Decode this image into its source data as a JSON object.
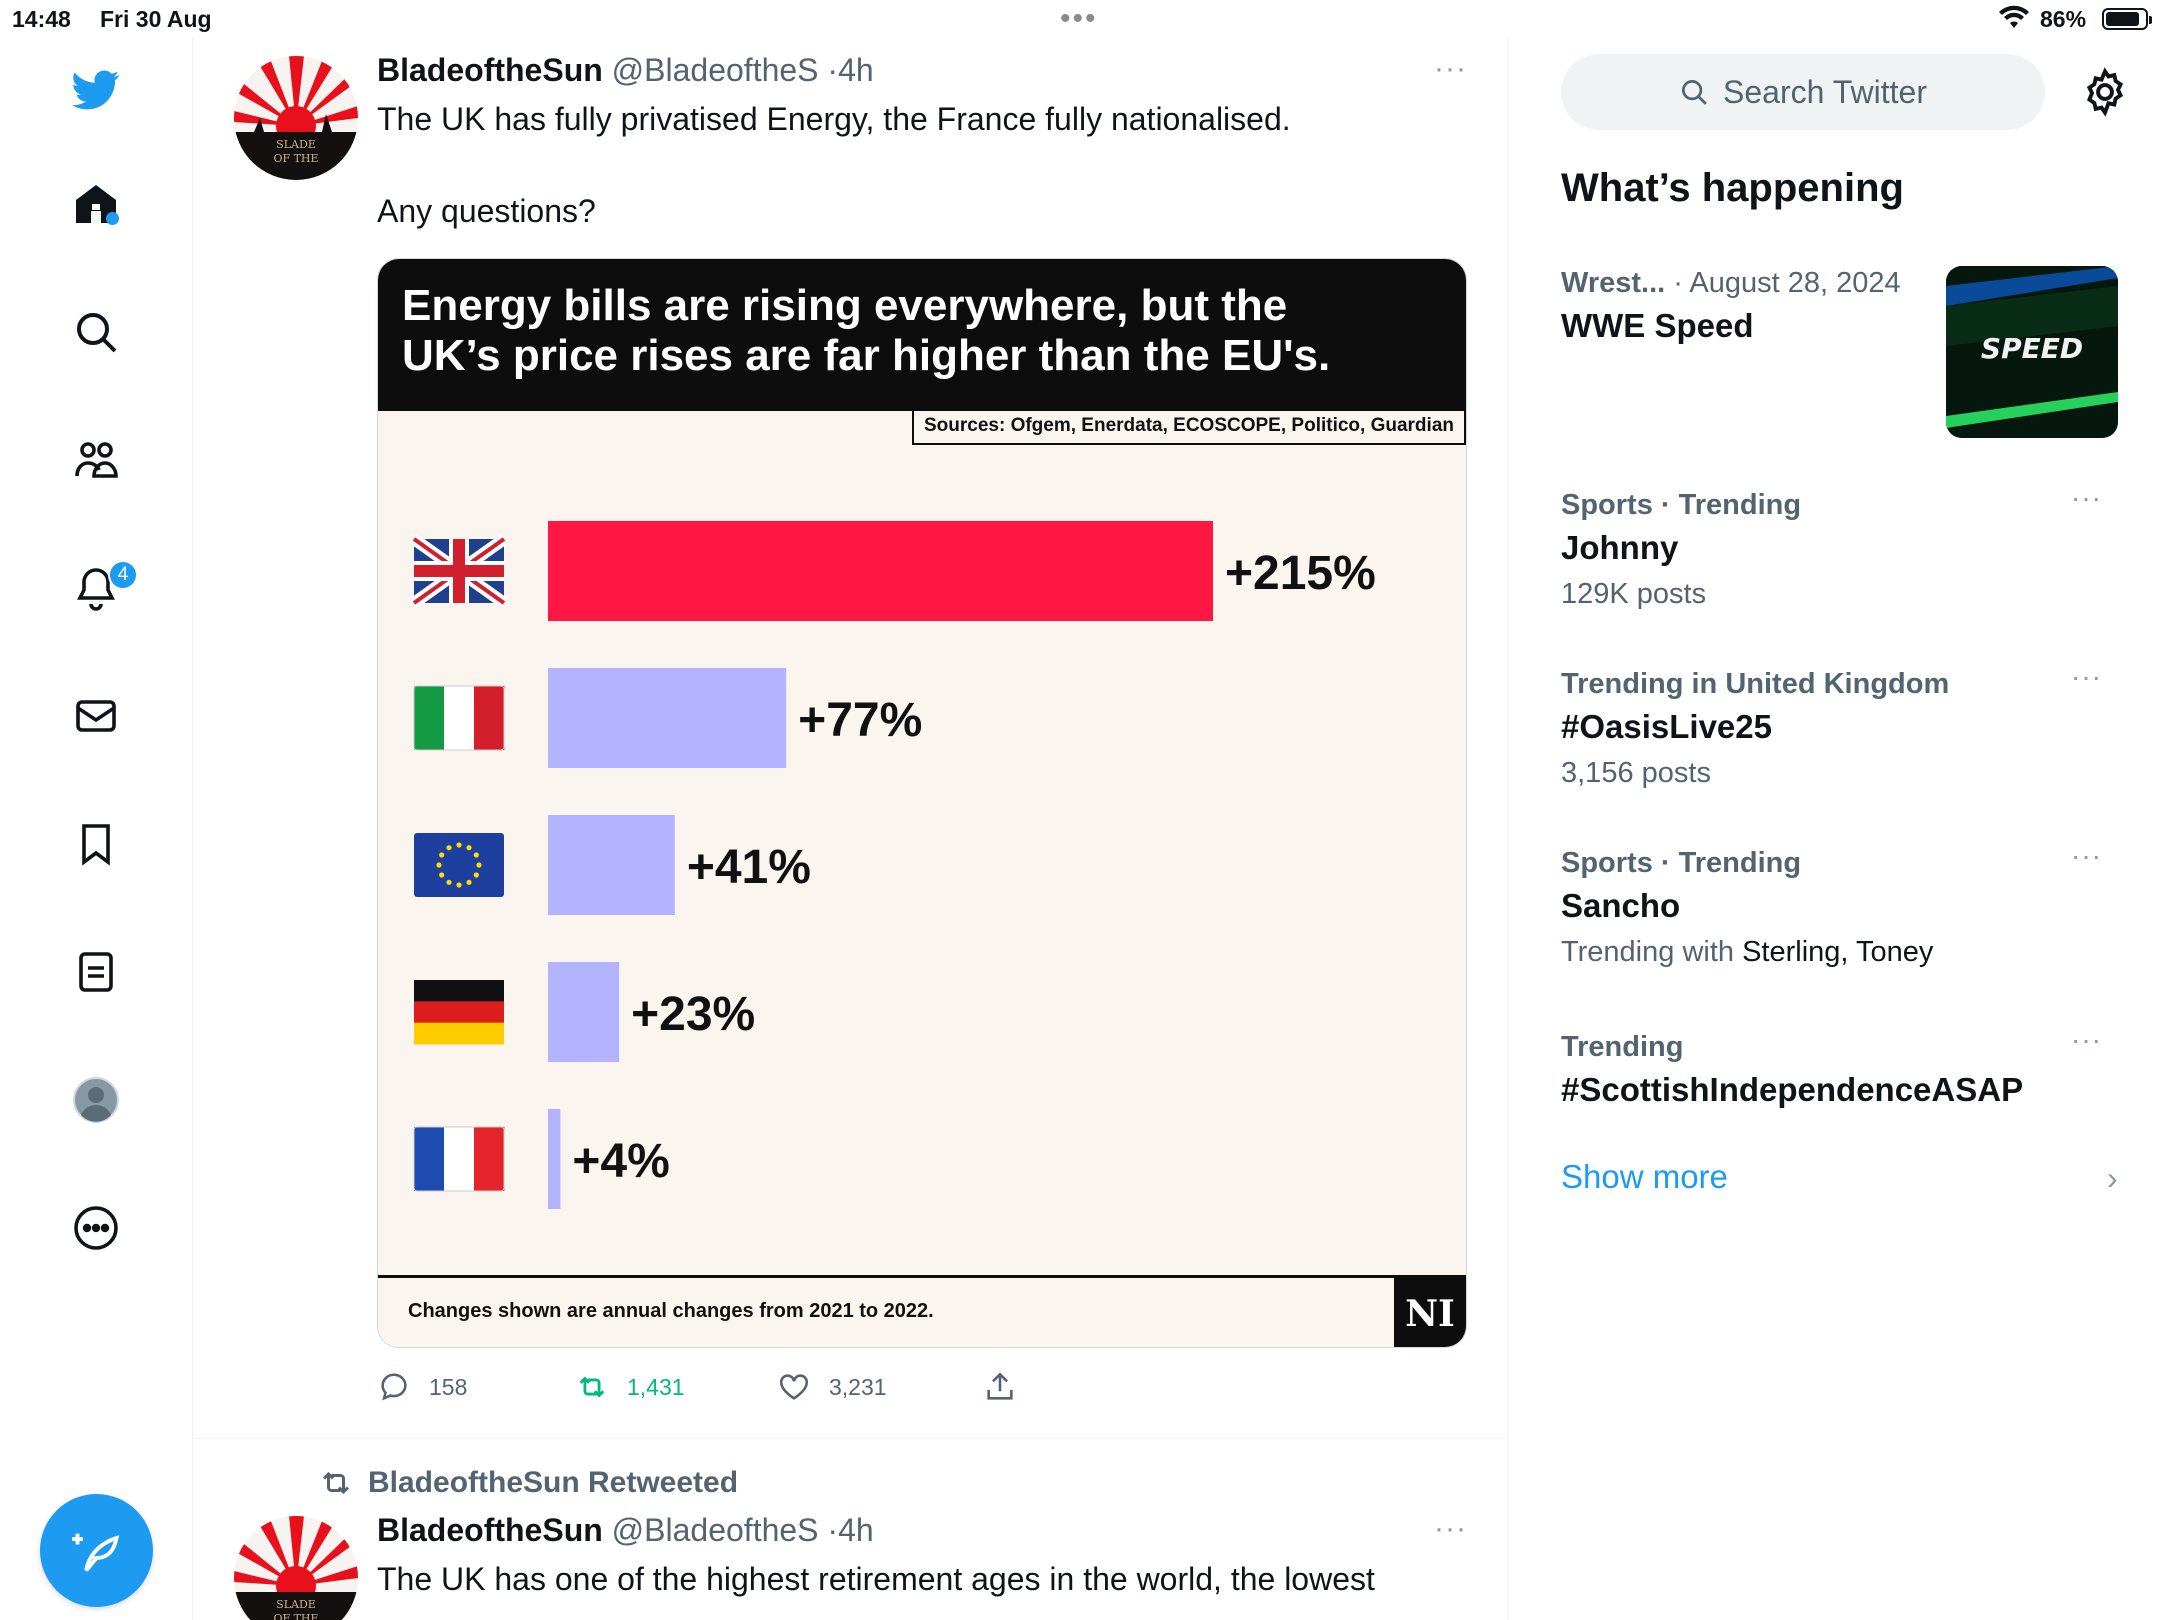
{
  "status_bar": {
    "time": "14:48",
    "date": "Fri 30 Aug",
    "battery_text": "86%",
    "battery_level": 0.86
  },
  "nav": {
    "notifications_badge": "4",
    "icons": [
      "twitter-logo-icon",
      "home-icon",
      "search-icon",
      "communities-icon",
      "notifications-icon",
      "messages-icon",
      "bookmarks-icon",
      "lists-icon",
      "profile-icon",
      "more-icon",
      "compose-icon"
    ]
  },
  "tweet1": {
    "name": "BladeoftheSun",
    "handle": "@BladeoftheS",
    "sep": "·",
    "ago": "4h",
    "more": "···",
    "text": "The UK has fully privatised Energy, the France fully nationalised.\n\nAny questions?",
    "image": {
      "headline": "Energy bills are rising everywhere, but the\nUK’s price rises are far higher than the EU's.",
      "sources": "Sources: Ofgem, Enerdata, ECOSCOPE, Politico, Guardian",
      "footnote": "Changes shown are annual changes from 2021 to 2022.",
      "logo": "NI"
    },
    "stats": {
      "replies": "158",
      "retweets": "1,431",
      "likes": "3,231"
    }
  },
  "tweet2": {
    "retweeted_by": "BladeoftheSun Retweeted",
    "name": "BladeoftheSun",
    "handle": "@BladeoftheS",
    "sep": "·",
    "ago": "4h",
    "more": "···",
    "text": "The UK has one of the highest retirement ages in the world, the lowest"
  },
  "chart_data": {
    "type": "bar",
    "orientation": "horizontal",
    "categories": [
      "UK",
      "Italy",
      "EU",
      "Germany",
      "France"
    ],
    "values": [
      215,
      77,
      41,
      23,
      4
    ],
    "value_labels": [
      "+215%",
      "+77%",
      "+41%",
      "+23%",
      "+4%"
    ],
    "colors": [
      "#ff1744",
      "#b3b3ff",
      "#b3b3ff",
      "#b3b3ff",
      "#b3b3ff"
    ],
    "xlim": [
      0,
      215
    ]
  },
  "sidebar": {
    "search_placeholder": "Search Twitter",
    "section_title": "What’s happening",
    "trends": [
      {
        "meta_strong": "Wrest...",
        "meta_light": " · August 28, 2024",
        "title": "WWE Speed",
        "sub": "",
        "sub_dark": "",
        "thumb_text": "SPEED"
      },
      {
        "meta_strong": "Sports · Trending",
        "meta_light": "",
        "title": "Johnny",
        "sub": "129K posts",
        "sub_dark": ""
      },
      {
        "meta_strong": "Trending in United Kingdom",
        "meta_light": "",
        "title": "#OasisLive25",
        "sub": "3,156 posts",
        "sub_dark": ""
      },
      {
        "meta_strong": "Sports · Trending",
        "meta_light": "",
        "title": "Sancho",
        "sub": "Trending with ",
        "sub_dark": "Sterling, Toney"
      },
      {
        "meta_strong": "Trending",
        "meta_light": "",
        "title": "#ScottishIndependenceASAP",
        "sub": "",
        "sub_dark": ""
      }
    ],
    "trend_more": "···",
    "show_more": "Show more",
    "show_more_chevron": "›"
  },
  "colors": {
    "accent": "#1d9bf0",
    "retweet_green": "#00ba7c",
    "uk_bar": "#ff1744",
    "other_bar": "#b3b3ff"
  }
}
